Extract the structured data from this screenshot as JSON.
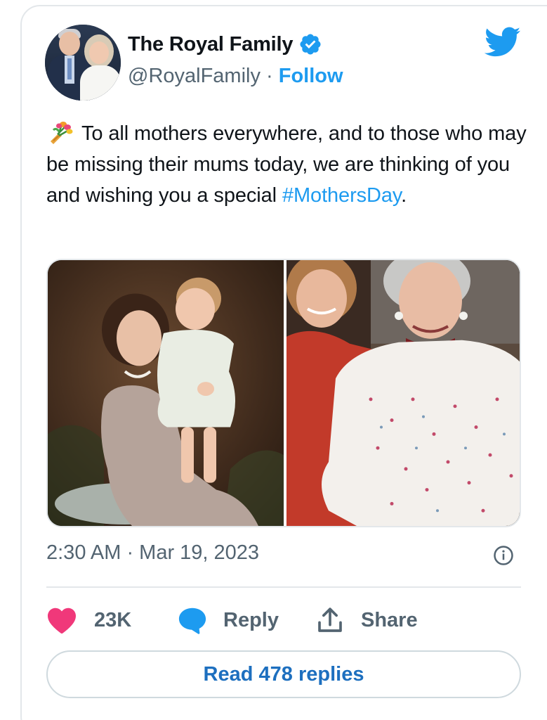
{
  "author": {
    "name": "The Royal Family",
    "handle": "@RoyalFamily",
    "separator": " · ",
    "follow_label": "Follow",
    "verified": true
  },
  "tweet": {
    "emoji": "bouquet",
    "text_main": "To all mothers everywhere, and to those who may be missing their mums today, we are thinking of you and wishing you a special ",
    "hashtag": "#MothersDay",
    "text_end": ".",
    "timestamp": "2:30 AM · Mar 19, 2023"
  },
  "actions": {
    "like_count": "23K",
    "reply_label": "Reply",
    "share_label": "Share"
  },
  "read_replies_label": "Read 478 replies",
  "colors": {
    "accent": "#1d9bf0",
    "like": "#f0387a",
    "reply_icon": "#1d9bf0",
    "text": "#0f1419",
    "muted": "#536471",
    "border": "#e3e7ea"
  },
  "icons": [
    "verified-badge-icon",
    "twitter-bird-icon",
    "bouquet-icon",
    "info-icon",
    "heart-icon",
    "reply-bubble-icon",
    "share-icon"
  ]
}
